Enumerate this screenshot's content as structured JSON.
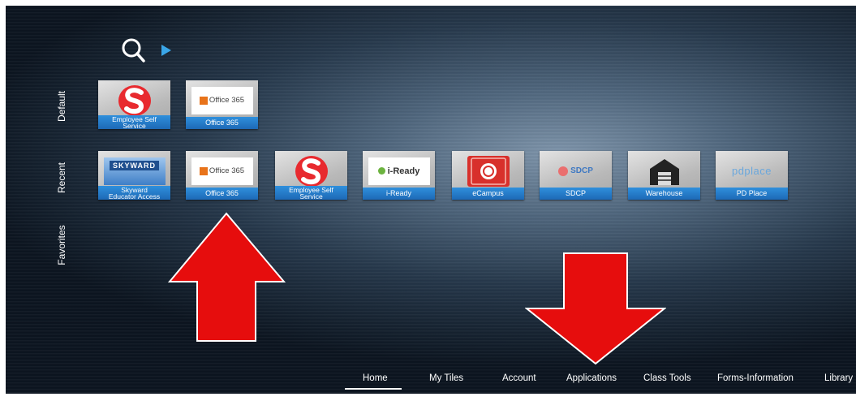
{
  "rows": {
    "default": "Default",
    "recent": "Recent",
    "favorites": "Favorites"
  },
  "default_tiles": [
    {
      "caption": [
        "Employee Self",
        "Service"
      ],
      "icon": "employee-self-service-logo"
    },
    {
      "caption": [
        "Office 365"
      ],
      "icon": "office-365-logo",
      "logo_text": "Office 365"
    }
  ],
  "recent_tiles": [
    {
      "caption": [
        "Skyward",
        "Educator Access"
      ],
      "icon": "skyward-logo",
      "logo_text": "SKYWARD"
    },
    {
      "caption": [
        "Office 365"
      ],
      "icon": "office-365-logo",
      "logo_text": "Office 365"
    },
    {
      "caption": [
        "Employee Self",
        "Service"
      ],
      "icon": "employee-self-service-logo"
    },
    {
      "caption": [
        "i-Ready"
      ],
      "icon": "i-ready-logo",
      "logo_text": "i-Ready"
    },
    {
      "caption": [
        "eCampus"
      ],
      "icon": "ecampus-logo"
    },
    {
      "caption": [
        "SDCP"
      ],
      "icon": "sdcp-logo",
      "logo_text": "SDCP"
    },
    {
      "caption": [
        "Warehouse"
      ],
      "icon": "warehouse-logo"
    },
    {
      "caption": [
        "PD Place"
      ],
      "icon": "pd-place-logo",
      "logo_text": "pdplace"
    }
  ],
  "nav": [
    "Home",
    "My Tiles",
    "Account",
    "Applications",
    "Class Tools",
    "Forms-Information",
    "Library"
  ],
  "active_nav": "Home",
  "colors": {
    "accent": "#3aa6e8",
    "caption_bar": "#1d69b6",
    "arrow": "#e60d0d"
  }
}
